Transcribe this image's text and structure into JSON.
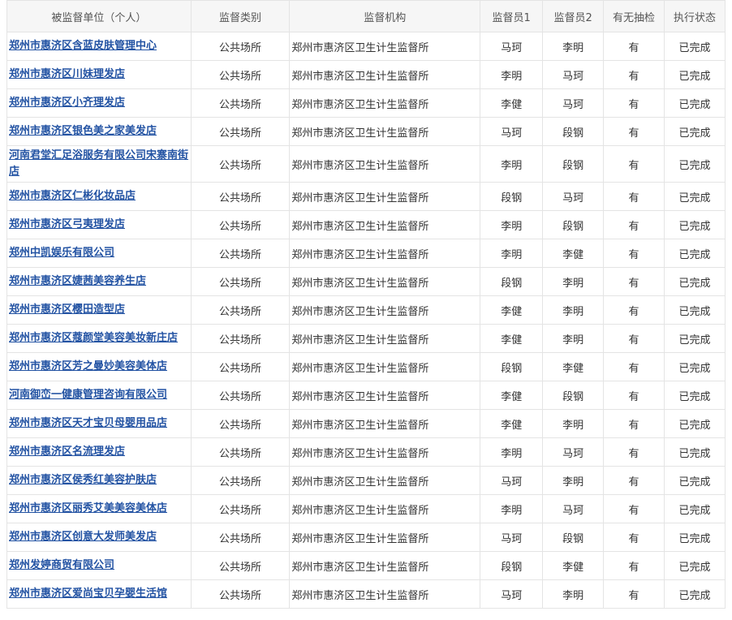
{
  "headers": [
    "被监督单位（个人）",
    "监督类别",
    "监督机构",
    "监督员1",
    "监督员2",
    "有无抽检",
    "执行状态"
  ],
  "rows": [
    {
      "unit": "郑州市惠济区含蓝皮肤管理中心",
      "category": "公共场所",
      "agency": "郑州市惠济区卫生计生监督所",
      "inspector1": "马珂",
      "inspector2": "李明",
      "sampling": "有",
      "status": "已完成"
    },
    {
      "unit": "郑州市惠济区川妹理发店",
      "category": "公共场所",
      "agency": "郑州市惠济区卫生计生监督所",
      "inspector1": "李明",
      "inspector2": "马珂",
      "sampling": "有",
      "status": "已完成"
    },
    {
      "unit": "郑州市惠济区小齐理发店",
      "category": "公共场所",
      "agency": "郑州市惠济区卫生计生监督所",
      "inspector1": "李健",
      "inspector2": "马珂",
      "sampling": "有",
      "status": "已完成"
    },
    {
      "unit": "郑州市惠济区银色美之家美发店",
      "category": "公共场所",
      "agency": "郑州市惠济区卫生计生监督所",
      "inspector1": "马珂",
      "inspector2": "段钢",
      "sampling": "有",
      "status": "已完成"
    },
    {
      "unit": "河南君堂汇足浴服务有限公司宋寨南街店",
      "category": "公共场所",
      "agency": "郑州市惠济区卫生计生监督所",
      "inspector1": "李明",
      "inspector2": "段钢",
      "sampling": "有",
      "status": "已完成"
    },
    {
      "unit": "郑州市惠济区仁彬化妆品店",
      "category": "公共场所",
      "agency": "郑州市惠济区卫生计生监督所",
      "inspector1": "段钢",
      "inspector2": "马珂",
      "sampling": "有",
      "status": "已完成"
    },
    {
      "unit": "郑州市惠济区弓夷理发店",
      "category": "公共场所",
      "agency": "郑州市惠济区卫生计生监督所",
      "inspector1": "李明",
      "inspector2": "段钢",
      "sampling": "有",
      "status": "已完成"
    },
    {
      "unit": "郑州中凯娱乐有限公司",
      "category": "公共场所",
      "agency": "郑州市惠济区卫生计生监督所",
      "inspector1": "李明",
      "inspector2": "李健",
      "sampling": "有",
      "status": "已完成"
    },
    {
      "unit": "郑州市惠济区婕茜美容养生店",
      "category": "公共场所",
      "agency": "郑州市惠济区卫生计生监督所",
      "inspector1": "段钢",
      "inspector2": "李明",
      "sampling": "有",
      "status": "已完成"
    },
    {
      "unit": "郑州市惠济区樱田造型店",
      "category": "公共场所",
      "agency": "郑州市惠济区卫生计生监督所",
      "inspector1": "李健",
      "inspector2": "李明",
      "sampling": "有",
      "status": "已完成"
    },
    {
      "unit": "郑州市惠济区蔻颜堂美容美妆新庄店",
      "category": "公共场所",
      "agency": "郑州市惠济区卫生计生监督所",
      "inspector1": "李健",
      "inspector2": "李明",
      "sampling": "有",
      "status": "已完成"
    },
    {
      "unit": "郑州市惠济区芳之曼妙美容美体店",
      "category": "公共场所",
      "agency": "郑州市惠济区卫生计生监督所",
      "inspector1": "段钢",
      "inspector2": "李健",
      "sampling": "有",
      "status": "已完成"
    },
    {
      "unit": "河南御峦一健康管理咨询有限公司",
      "category": "公共场所",
      "agency": "郑州市惠济区卫生计生监督所",
      "inspector1": "李健",
      "inspector2": "段钢",
      "sampling": "有",
      "status": "已完成"
    },
    {
      "unit": "郑州市惠济区天才宝贝母婴用品店",
      "category": "公共场所",
      "agency": "郑州市惠济区卫生计生监督所",
      "inspector1": "李健",
      "inspector2": "李明",
      "sampling": "有",
      "status": "已完成"
    },
    {
      "unit": "郑州市惠济区名流理发店",
      "category": "公共场所",
      "agency": "郑州市惠济区卫生计生监督所",
      "inspector1": "李明",
      "inspector2": "马珂",
      "sampling": "有",
      "status": "已完成"
    },
    {
      "unit": "郑州市惠济区侯秀红美容护肤店",
      "category": "公共场所",
      "agency": "郑州市惠济区卫生计生监督所",
      "inspector1": "马珂",
      "inspector2": "李明",
      "sampling": "有",
      "status": "已完成"
    },
    {
      "unit": "郑州市惠济区丽秀艾美美容美体店",
      "category": "公共场所",
      "agency": "郑州市惠济区卫生计生监督所",
      "inspector1": "李明",
      "inspector2": "马珂",
      "sampling": "有",
      "status": "已完成"
    },
    {
      "unit": "郑州市惠济区创意大发师美发店",
      "category": "公共场所",
      "agency": "郑州市惠济区卫生计生监督所",
      "inspector1": "马珂",
      "inspector2": "段钢",
      "sampling": "有",
      "status": "已完成"
    },
    {
      "unit": "郑州发婷商贸有限公司",
      "category": "公共场所",
      "agency": "郑州市惠济区卫生计生监督所",
      "inspector1": "段钢",
      "inspector2": "李健",
      "sampling": "有",
      "status": "已完成"
    },
    {
      "unit": "郑州市惠济区爱尚宝贝孕婴生活馆",
      "category": "公共场所",
      "agency": "郑州市惠济区卫生计生监督所",
      "inspector1": "马珂",
      "inspector2": "李明",
      "sampling": "有",
      "status": "已完成"
    }
  ],
  "colors": {
    "link": "#2353a3",
    "border": "#e4e4e4",
    "header_bg": "#f6f6f6",
    "text": "#333333"
  }
}
